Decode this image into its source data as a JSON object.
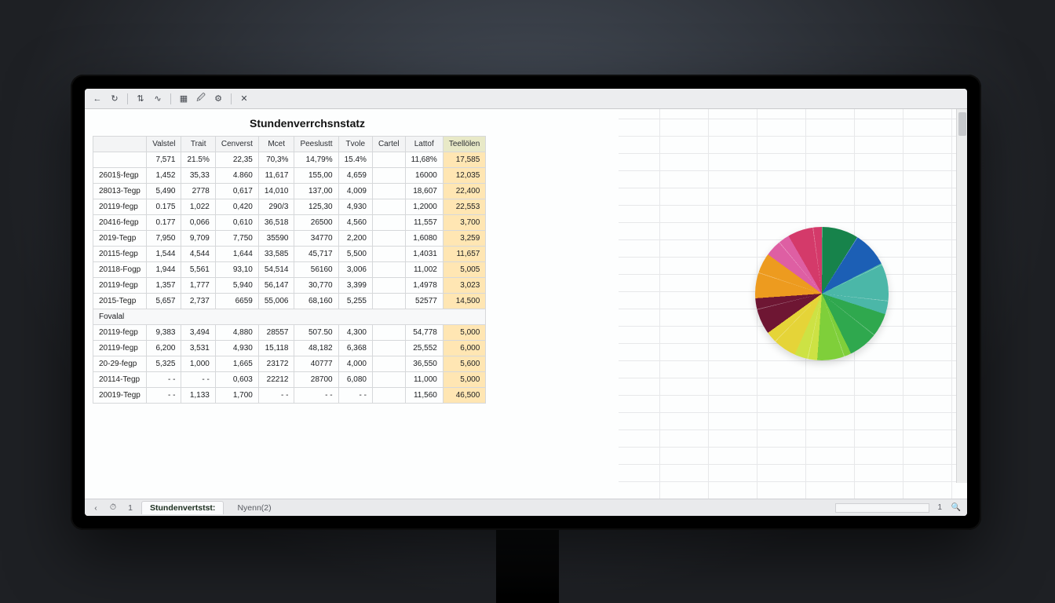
{
  "title": "Stundenverrchsnstatz",
  "toolbar_icons": [
    "back",
    "refresh",
    "sep",
    "sort",
    "down",
    "sep",
    "grid",
    "link",
    "gear",
    "sep",
    "close"
  ],
  "columns": [
    "",
    "Valstel",
    "Trait",
    "Cenverst",
    "Mcet",
    "Peeslustt",
    "Tvole",
    "Cartel",
    "Lattof",
    "Teellölen"
  ],
  "summary_row": [
    "",
    "7,571",
    "21.5%",
    "22,35",
    "70,3%",
    "14,79%",
    "15.4%",
    "",
    "11,68%",
    "17,585"
  ],
  "rows": [
    {
      "label": "2601§-fegp",
      "cells": [
        "1,452",
        "35,33",
        "4.860",
        "11,617",
        "155,00",
        "4,659",
        "",
        "16000",
        "12,035"
      ]
    },
    {
      "label": "28013-Tegp",
      "cells": [
        "5,490",
        "2778",
        "0,617",
        "14,010",
        "137,00",
        "4,009",
        "",
        "18,607",
        "22,400"
      ]
    },
    {
      "label": "20119-fegp",
      "cells": [
        "0.175",
        "1,022",
        "0,420",
        "290/3",
        "125,30",
        "4,930",
        "",
        "1,2000",
        "22,553"
      ]
    },
    {
      "label": "20416-fegp",
      "cells": [
        "0.177",
        "0,066",
        "0,610",
        "36,518",
        "26500",
        "4,560",
        "",
        "11,557",
        "3,700"
      ]
    },
    {
      "label": "2019-Tegp",
      "cells": [
        "7,950",
        "9,709",
        "7,750",
        "35590",
        "34770",
        "2,200",
        "",
        "1,6080",
        "3,259"
      ]
    },
    {
      "label": "20115-fegp",
      "cells": [
        "1,544",
        "4,544",
        "1,644",
        "33,585",
        "45,717",
        "5,500",
        "",
        "1,4031",
        "11,657"
      ]
    },
    {
      "label": "20118-Fogp",
      "cells": [
        "1,944",
        "5,561",
        "93,10",
        "54,514",
        "56160",
        "3,006",
        "",
        "11,002",
        "5,005"
      ]
    },
    {
      "label": "20119-fegp",
      "cells": [
        "1,357",
        "1,777",
        "5,940",
        "56,147",
        "30,770",
        "3,399",
        "",
        "1,4978",
        "3,023"
      ]
    },
    {
      "label": "2015-Tegp",
      "cells": [
        "5,657",
        "2,737",
        "6659",
        "55,006",
        "68,160",
        "5,255",
        "",
        "52577",
        "14,500"
      ]
    }
  ],
  "subheader": "Fovalal",
  "rows2": [
    {
      "label": "20119-fegp",
      "cells": [
        "9,383",
        "3,494",
        "4,880",
        "28557",
        "507.50",
        "4,300",
        "",
        "54,778",
        "5,000"
      ]
    },
    {
      "label": "20119-fegp",
      "cells": [
        "6,200",
        "3,531",
        "4,930",
        "15,118",
        "48,182",
        "6,368",
        "",
        "25,552",
        "6,000"
      ]
    },
    {
      "label": "20-29-fegp",
      "cells": [
        "5,325",
        "1,000",
        "1,665",
        "23172",
        "40777",
        "4,000",
        "",
        "36,550",
        "5,600"
      ]
    },
    {
      "label": "20114-Tegp",
      "cells": [
        "- -",
        "- -",
        "0,603",
        "22212",
        "28700",
        "6,080",
        "",
        "11,000",
        "5,000"
      ]
    },
    {
      "label": "20019-Tegp",
      "cells": [
        "- -",
        "1,133",
        "1,700",
        "- -",
        "- -",
        "- -",
        "",
        "11,560",
        "46,500"
      ]
    }
  ],
  "tabs": {
    "active": "Stundenvertstst:",
    "inactive": "Nyenn(2)",
    "page": "1"
  },
  "chart_data": {
    "type": "pie",
    "title": "",
    "slices": [
      {
        "color": "#17834b",
        "value": 9
      },
      {
        "color": "#1c5fb5",
        "value": 9
      },
      {
        "color": "#4bb7a8",
        "value": 12
      },
      {
        "color": "#2fa84e",
        "value": 13
      },
      {
        "color": "#7fcf3a",
        "value": 8
      },
      {
        "color": "#cde244",
        "value": 6
      },
      {
        "color": "#e5d438",
        "value": 8
      },
      {
        "color": "#6e1633",
        "value": 9
      },
      {
        "color": "#ed9b1f",
        "value": 11
      },
      {
        "color": "#de5fa3",
        "value": 7
      },
      {
        "color": "#d43a6a",
        "value": 8
      }
    ]
  }
}
